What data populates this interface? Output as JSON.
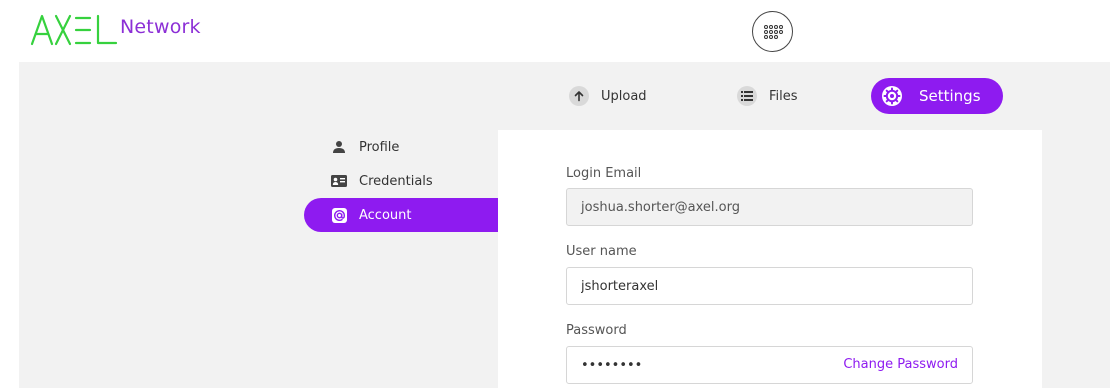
{
  "brand": {
    "logo_text": "AXEL",
    "network_label": "Network"
  },
  "header": {
    "apps_icon": "grid-dots-icon"
  },
  "tabs": [
    {
      "label": "Upload",
      "icon": "arrow-up-icon",
      "active": false
    },
    {
      "label": "Files",
      "icon": "list-icon",
      "active": false
    },
    {
      "label": "Settings",
      "icon": "gear-icon",
      "active": true
    }
  ],
  "side_nav": [
    {
      "label": "Profile",
      "icon": "person-icon",
      "active": false
    },
    {
      "label": "Credentials",
      "icon": "id-card-icon",
      "active": false
    },
    {
      "label": "Account",
      "icon": "at-sign-icon",
      "active": true
    }
  ],
  "form": {
    "login_email": {
      "label": "Login Email",
      "value": "joshua.shorter@axel.org"
    },
    "username": {
      "label": "User name",
      "value": "jshorteraxel"
    },
    "password": {
      "label": "Password",
      "value": "••••••••",
      "change_label": "Change Password"
    }
  },
  "colors": {
    "accent": "#8e1bf0",
    "logo_green": "#36d13e",
    "background": "#f2f2f2"
  }
}
